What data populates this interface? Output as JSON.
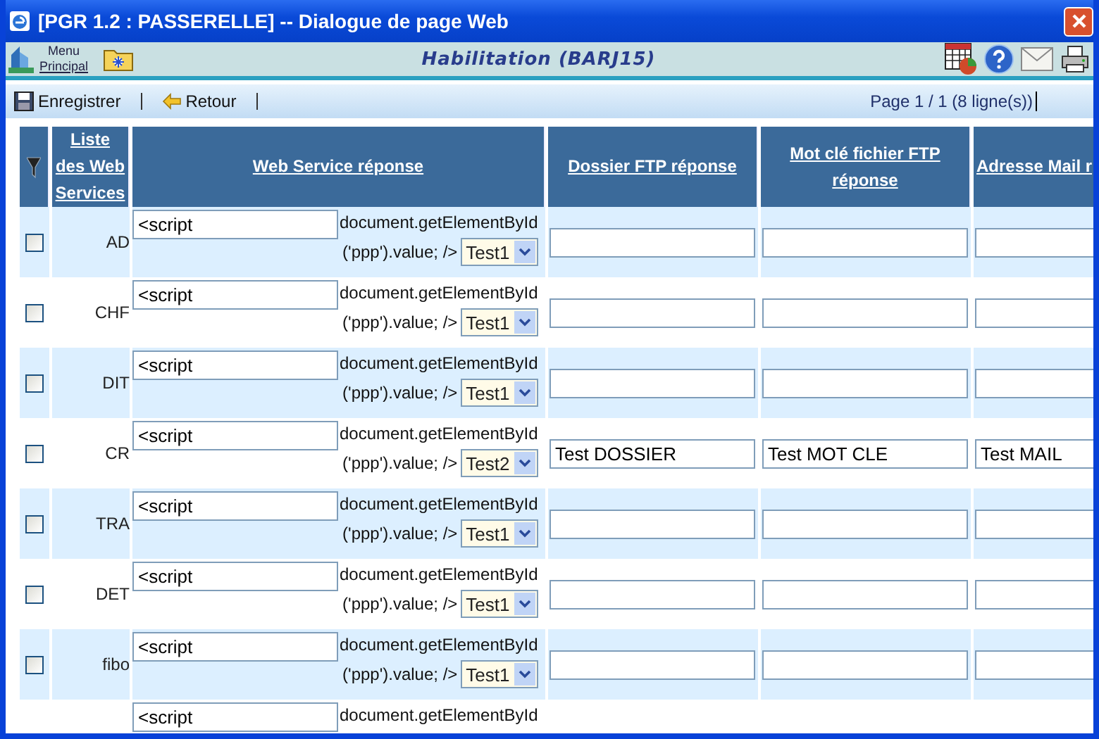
{
  "window": {
    "title": "[PGR 1.2 : PASSERELLE] -- Dialogue de page Web"
  },
  "toolbar": {
    "menu_link_line1": "Menu",
    "menu_link_line2": "Principal",
    "heading": "Habilitation (BARJ15)"
  },
  "actions": [
    {
      "kind": "save",
      "label": "Enregistrer"
    },
    {
      "kind": "back",
      "label": "Retour"
    }
  ],
  "pagination": "Page 1 / 1 (8 ligne(s))",
  "table": {
    "columns": [
      {
        "label": "Liste des Web Services"
      },
      {
        "label": "Web Service réponse"
      },
      {
        "label": "Dossier FTP réponse"
      },
      {
        "label": "Mot clé fichier FTP réponse"
      },
      {
        "label": "Adresse Mail r"
      }
    ],
    "rows": [
      {
        "checked": false,
        "name": "AD",
        "script": "<script",
        "code_line1": "document.getElementById",
        "code_line2": "('ppp').value; />",
        "select": "Test1",
        "dossier": "",
        "mot_cle": "",
        "mail": ""
      },
      {
        "checked": false,
        "name": "CHF",
        "script": "<script",
        "code_line1": "document.getElementById",
        "code_line2": "('ppp').value; />",
        "select": "Test1",
        "dossier": "",
        "mot_cle": "",
        "mail": ""
      },
      {
        "checked": false,
        "name": "DIT",
        "script": "<script",
        "code_line1": "document.getElementById",
        "code_line2": "('ppp').value; />",
        "select": "Test1",
        "dossier": "",
        "mot_cle": "",
        "mail": ""
      },
      {
        "checked": false,
        "name": "CR",
        "script": "<script",
        "code_line1": "document.getElementById",
        "code_line2": "('ppp').value; />",
        "select": "Test2",
        "dossier": "Test DOSSIER",
        "mot_cle": "Test MOT CLE",
        "mail": "Test MAIL"
      },
      {
        "checked": false,
        "name": "TRA",
        "script": "<script",
        "code_line1": "document.getElementById",
        "code_line2": "('ppp').value; />",
        "select": "Test1",
        "dossier": "",
        "mot_cle": "",
        "mail": ""
      },
      {
        "checked": false,
        "name": "DET",
        "script": "<script",
        "code_line1": "document.getElementById",
        "code_line2": "('ppp').value; />",
        "select": "Test1",
        "dossier": "",
        "mot_cle": "",
        "mail": ""
      },
      {
        "checked": false,
        "name": "fibo",
        "script": "<script",
        "code_line1": "document.getElementById",
        "code_line2": "('ppp').value; />",
        "select": "Test1",
        "dossier": "",
        "mot_cle": "",
        "mail": ""
      },
      {
        "script": "<script",
        "code_line1": "document.getElementById"
      }
    ]
  }
}
